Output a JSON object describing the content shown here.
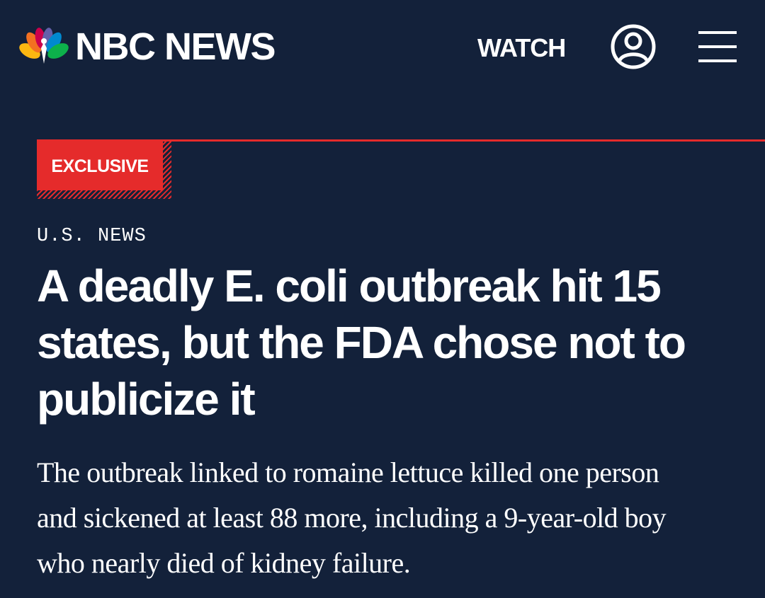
{
  "header": {
    "logo_text": "NBC NEWS",
    "watch_label": "WATCH",
    "account_icon": "user-account-icon",
    "menu_icon": "hamburger-menu-icon"
  },
  "badge": {
    "label": "EXCLUSIVE",
    "color": "#e52b2b"
  },
  "article": {
    "section": "U.S. NEWS",
    "headline": "A deadly E. coli outbreak hit 15 states, but the FDA chose not to publicize it",
    "dek": "The outbreak linked to romaine lettuce killed one person and sickened at least 88 more, including a 9-year-old boy who nearly died of kidney failure."
  },
  "colors": {
    "background": "#13213a",
    "text": "#ffffff",
    "accent": "#e52b2b"
  }
}
